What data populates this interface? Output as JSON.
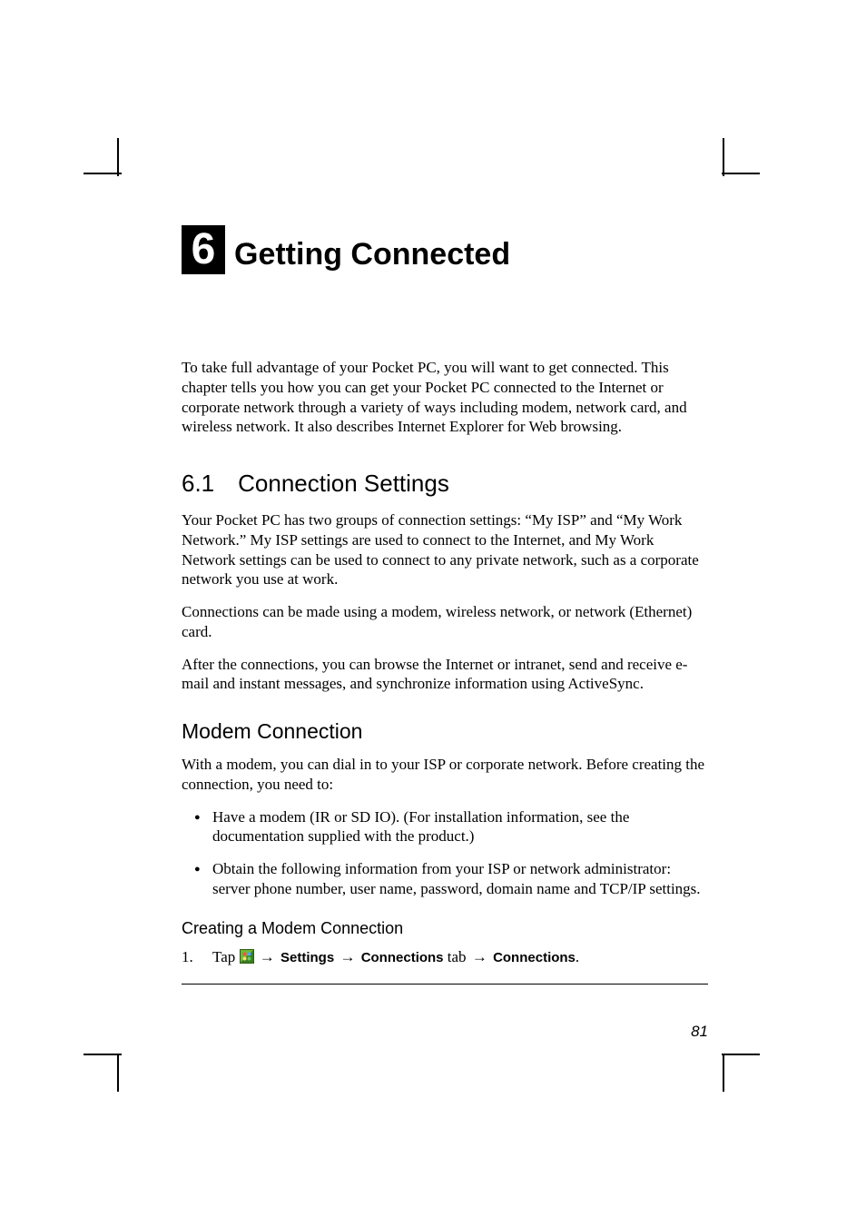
{
  "chapter": {
    "number": "6",
    "title": "Getting Connected"
  },
  "intro": "To take full advantage of your Pocket PC, you will want to get connected. This chapter tells you how you can get your Pocket PC connected to the Internet or corporate network through a variety of ways including modem, network card, and wireless network. It also describes Internet Explorer for Web browsing.",
  "section_6_1": {
    "heading": "6.1 Connection Settings",
    "p1": "Your Pocket PC has two groups of connection settings: “My ISP” and “My Work Network.” My ISP settings are used to connect to the Internet, and My Work Network settings can be used to connect to any private network, such as a corporate network you use at work.",
    "p2": "Connections can be made using a modem, wireless network, or network (Ethernet) card.",
    "p3": "After the connections, you can browse the Internet or intranet, send and receive e-mail and instant messages, and synchronize information using ActiveSync."
  },
  "modem": {
    "heading": "Modem Connection",
    "intro": "With a modem, you can dial in to your ISP or corporate network. Before creating the connection, you need to:",
    "bullets": [
      "Have a modem (IR or SD IO). (For installation information, see the documentation supplied with the product.)",
      "Obtain the following information from your ISP or network administrator: server phone number, user name, password, domain name and TCP/IP settings."
    ],
    "create_heading": "Creating a Modem Connection",
    "step1": {
      "num": "1.",
      "lead": "Tap ",
      "arrow": "→",
      "settings": "Settings",
      "connections": "Connections",
      "tab_word": " tab ",
      "period": "."
    }
  },
  "page_number": "81"
}
